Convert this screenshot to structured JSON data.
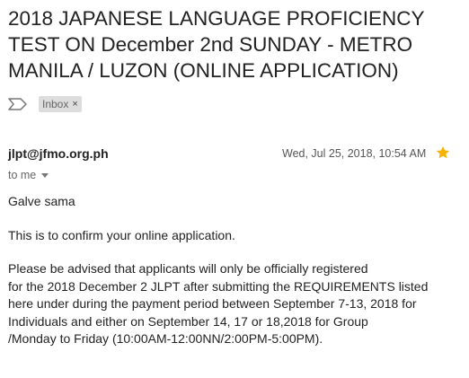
{
  "subject": {
    "line1": "2018 JAPANESE LANGUAGE PROFICIENCY",
    "line2": "TEST ON December 2nd SUNDAY - METRO",
    "line3": "MANILA / LUZON (ONLINE APPLICATION)"
  },
  "labels": {
    "important_icon": "importance-marker-icon",
    "inbox_label": "Inbox",
    "inbox_close": "×"
  },
  "message": {
    "sender": "jlpt@jfmo.org.ph",
    "timestamp": "Wed, Jul 25, 2018, 10:54 AM",
    "star_icon": "star-icon",
    "star_color": "#f4b400",
    "recipient": "to me",
    "body": {
      "greeting": "Galve sama",
      "confirm": "This is to confirm your online application.",
      "para_lines": [
        "Please be advised that applicants will only be officially registered",
        "for the 2018 December 2 JLPT after submitting the REQUIREMENTS listed",
        "here under during the payment period between September 7-13, 2018 for",
        "Individuals and either on September 14, 17 or 18,2018 for Group",
        "/Monday to Friday (10:00AM-12:00NN/2:00PM-5:00PM)."
      ]
    }
  }
}
